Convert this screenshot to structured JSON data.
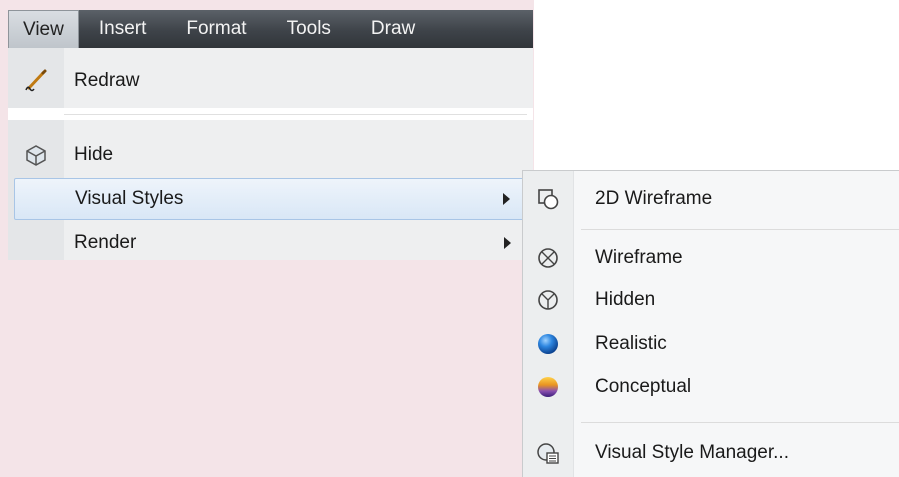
{
  "menubar": {
    "items": [
      "View",
      "Insert",
      "Format",
      "Tools",
      "Draw"
    ]
  },
  "view_menu": {
    "items": [
      {
        "label": "Redraw",
        "icon": "pencil-icon"
      },
      {
        "label": "Hide",
        "icon": "box-hide-icon"
      },
      {
        "label": "Visual Styles",
        "submenu": true
      },
      {
        "label": "Render",
        "submenu": true
      }
    ]
  },
  "visual_styles_menu": {
    "items": [
      {
        "label": "2D Wireframe",
        "icon": "2d-wireframe-icon"
      },
      {
        "label": "Wireframe",
        "icon": "wireframe-sphere-icon"
      },
      {
        "label": "Hidden",
        "icon": "hidden-sphere-icon"
      },
      {
        "label": "Realistic",
        "icon": "realistic-sphere-icon"
      },
      {
        "label": "Conceptual",
        "icon": "conceptual-sphere-icon"
      },
      {
        "label": "Visual Style Manager...",
        "icon": "visual-style-manager-icon"
      }
    ]
  },
  "colors": {
    "menubar": "#3e4349",
    "highlight": "#d9e7f6",
    "realistic": "#1f6fd0",
    "conceptual_top": "#f2a81e",
    "conceptual_bottom": "#6b3fb5"
  }
}
